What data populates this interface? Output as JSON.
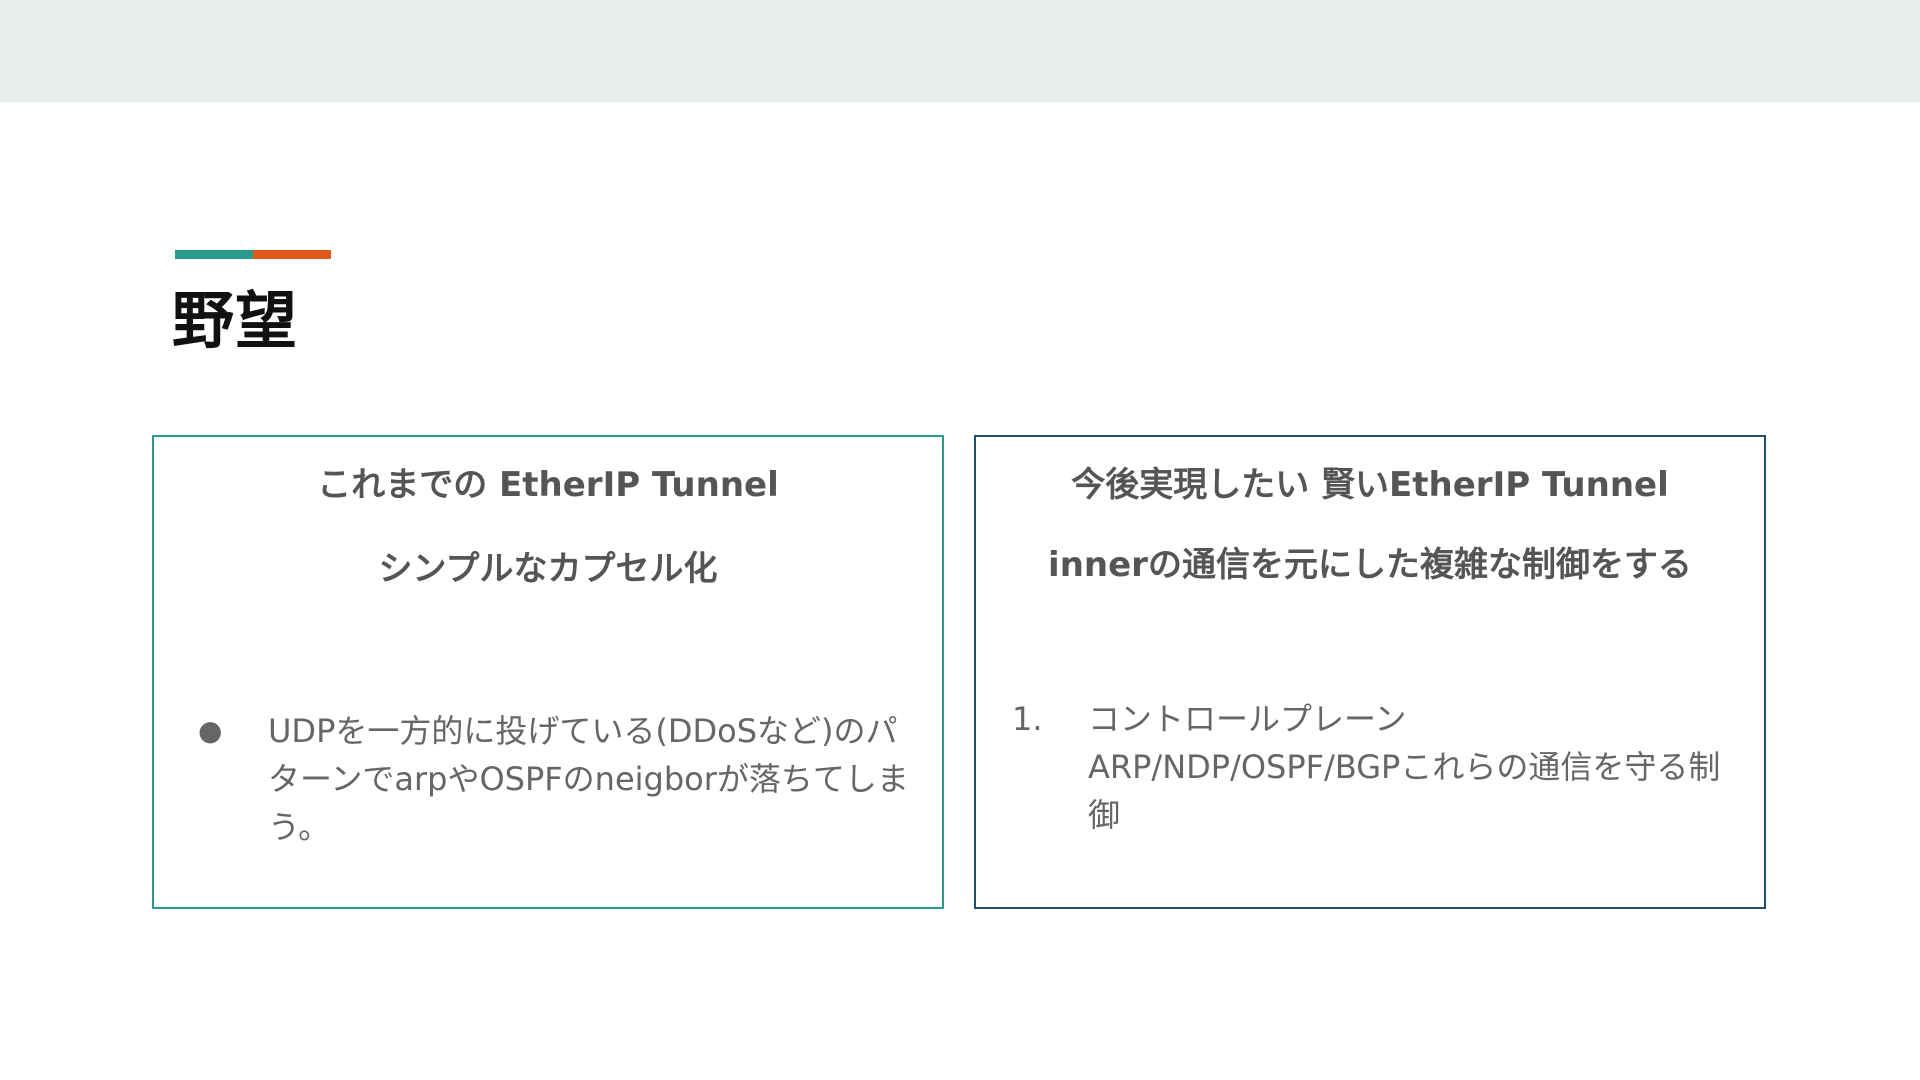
{
  "slide": {
    "title": "野望",
    "accent_colors": {
      "teal": "#2a9a8d",
      "orange": "#e0581a"
    }
  },
  "left_panel": {
    "heading": "これまでの EtherIP Tunnel",
    "subheading": "シンプルなカプセル化",
    "border_color": "#2a9a8d",
    "bullet_marker": "●",
    "bullet_text": "UDPを一方的に投げている(DDoSなど)のパターンでarpやOSPFのneigborが落ちてしまう。"
  },
  "right_panel": {
    "heading": "今後実現したい  賢いEtherIP Tunnel",
    "subheading": "innerの通信を元にした複雑な制御をする",
    "border_color": "#1f4e6b",
    "item_number": "1.",
    "item_line1": "コントロールプレーン",
    "item_line2": "ARP/NDP/OSPF/BGPこれらの通信を守る制御"
  }
}
